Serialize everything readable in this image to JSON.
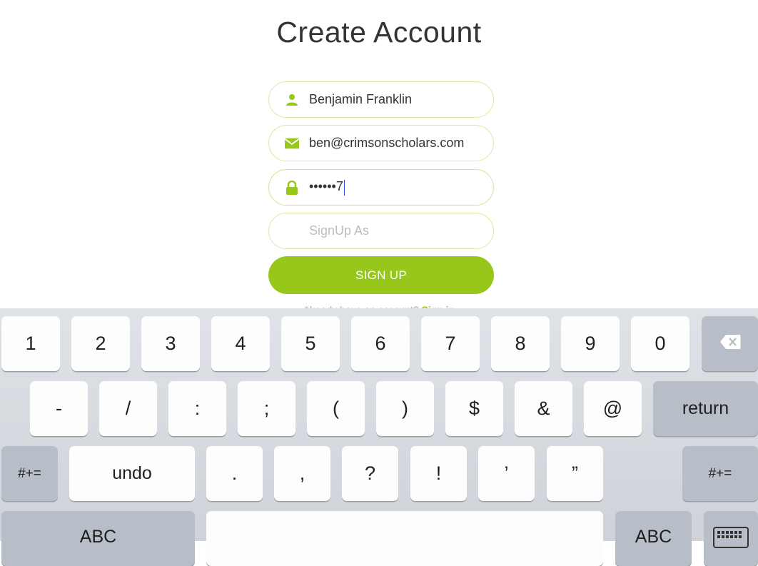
{
  "title": "Create Account",
  "form": {
    "name_value": "Benjamin Franklin",
    "email_value": "ben@crimsonscholars.com",
    "password_masked": "••••••",
    "password_last_char": "7",
    "role_placeholder": "SignUp As",
    "submit_label": "SIGN UP",
    "already_text": "Already have an account?",
    "signin_link": "Sign in"
  },
  "colors": {
    "accent": "#97c71a",
    "field_border": "#d9e8a8",
    "keyboard_bg": "#d5d9df"
  },
  "keyboard": {
    "row1": [
      "1",
      "2",
      "3",
      "4",
      "5",
      "6",
      "7",
      "8",
      "9",
      "0"
    ],
    "row2": [
      "-",
      "/",
      ":",
      ";",
      "(",
      ")",
      "$",
      "&",
      "@"
    ],
    "return_label": "return",
    "row3_left": "#+=",
    "undo_label": "undo",
    "row3": [
      ".",
      ",",
      "?",
      "!",
      "’",
      "”"
    ],
    "row3_right": "#+=",
    "abc_left": "ABC",
    "abc_right": "ABC",
    "icons": {
      "delete": "backspace-icon",
      "hide": "keyboard-icon"
    }
  }
}
